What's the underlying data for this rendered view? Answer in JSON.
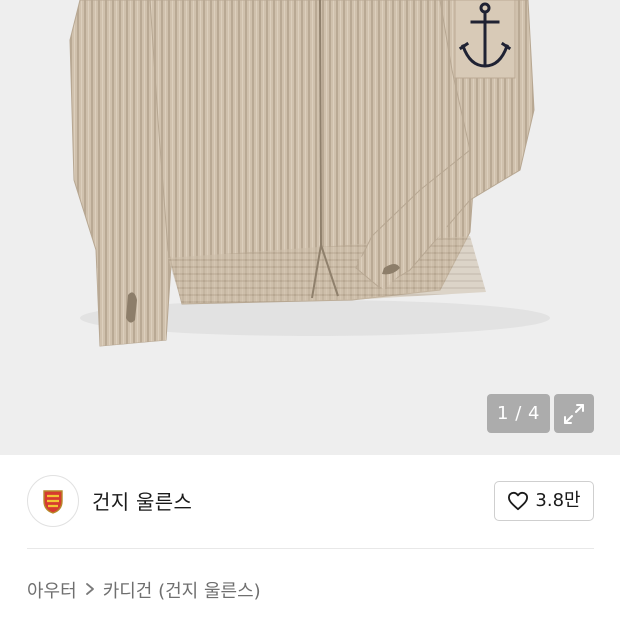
{
  "gallery": {
    "counter": "1 / 4",
    "current_page": 1,
    "total_pages": 4,
    "expand_icon": "expand-arrows-icon",
    "background_color": "#eeeeee"
  },
  "seller": {
    "name": "건지 울른스",
    "logo_icon": "brand-crest-icon",
    "like_count": "3.8만",
    "like_icon": "heart-outline-icon"
  },
  "breadcrumb": {
    "category": "아우터",
    "separator_icon": "chevron-right-icon",
    "subcategory": "카디건 (건지 울른스)"
  }
}
